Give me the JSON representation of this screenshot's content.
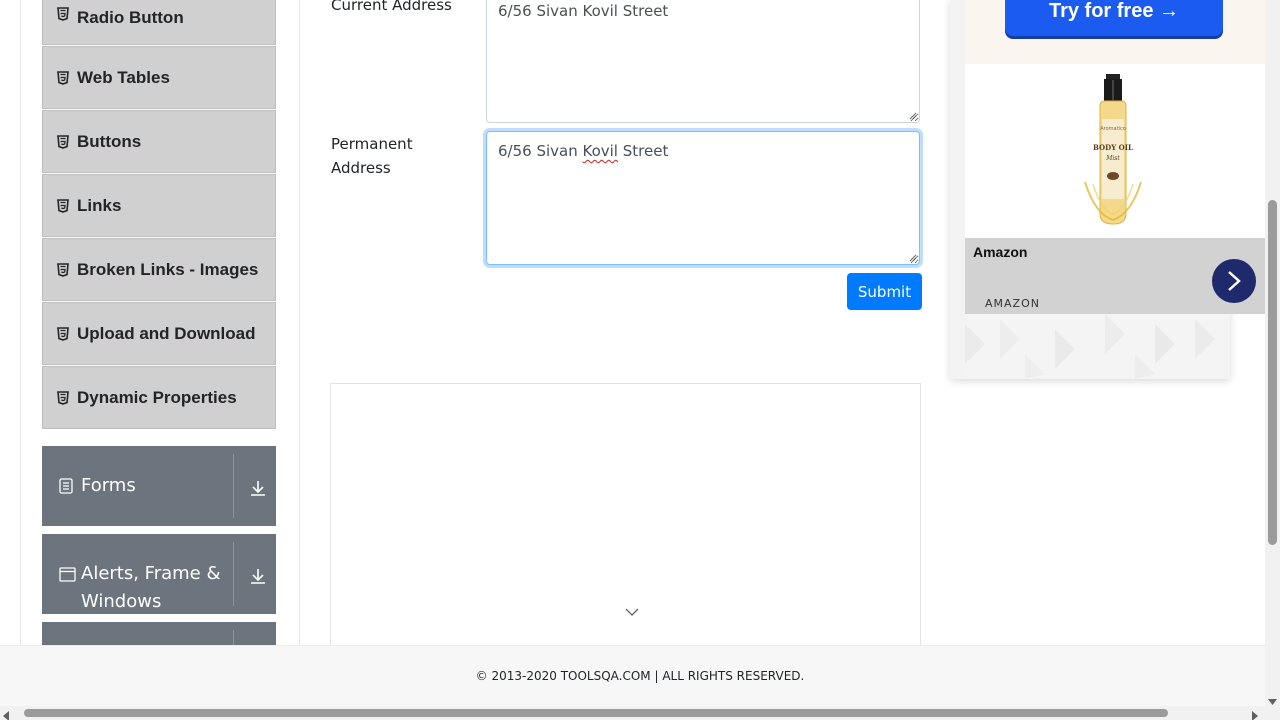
{
  "sidebar": {
    "elements": [
      {
        "label": "Radio Button",
        "icon": "html5-icon"
      },
      {
        "label": "Web Tables",
        "icon": "html5-icon"
      },
      {
        "label": "Buttons",
        "icon": "html5-icon"
      },
      {
        "label": "Links",
        "icon": "html5-icon"
      },
      {
        "label": "Broken Links - Images",
        "icon": "html5-icon"
      },
      {
        "label": "Upload and Download",
        "icon": "html5-icon"
      },
      {
        "label": "Dynamic Properties",
        "icon": "html5-icon"
      }
    ],
    "groups": [
      {
        "label": "Forms",
        "icon": "document-icon",
        "toggle_icon": "download-arrow-icon"
      },
      {
        "label_line1": "Alerts, Frame &",
        "label_line2": "Windows",
        "icon": "browser-window-icon",
        "toggle_icon": "download-arrow-icon"
      }
    ]
  },
  "form": {
    "current_address": {
      "label": "Current Address",
      "value": "6/56 Sivan Kovil Street"
    },
    "permanent_address": {
      "label_line1": "Permanent",
      "label_line2": "Address",
      "value_before": "6/56 Sivan ",
      "value_misspelled": "Kovil",
      "value_after": " Street"
    },
    "submit_label": "Submit"
  },
  "ad": {
    "cta": "Try for free →",
    "product_brand": "Aromatico",
    "product_name_line1": "BODY OIL",
    "product_name_line2": "Mist",
    "advertiser": "Amazon",
    "source": "AMAZON"
  },
  "footer": {
    "text": "© 2013-2020 TOOLSQA.COM | ALL RIGHTS RESERVED."
  },
  "colors": {
    "primary": "#007bff",
    "sidebar_group": "#6c757d",
    "sidebar_item": "#d0d0d0",
    "ad_cta": "#1b5bf0"
  }
}
